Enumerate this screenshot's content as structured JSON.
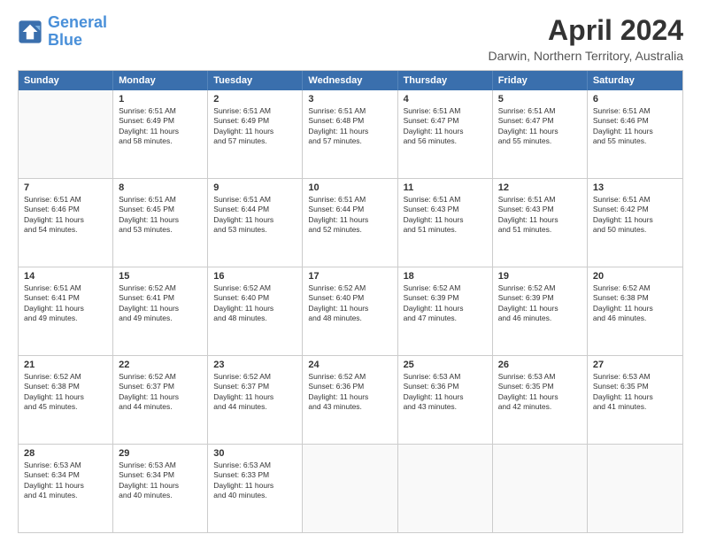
{
  "logo": {
    "line1": "General",
    "line2": "Blue"
  },
  "title": "April 2024",
  "subtitle": "Darwin, Northern Territory, Australia",
  "header_days": [
    "Sunday",
    "Monday",
    "Tuesday",
    "Wednesday",
    "Thursday",
    "Friday",
    "Saturday"
  ],
  "weeks": [
    [
      {
        "day": "",
        "info": ""
      },
      {
        "day": "1",
        "info": "Sunrise: 6:51 AM\nSunset: 6:49 PM\nDaylight: 11 hours\nand 58 minutes."
      },
      {
        "day": "2",
        "info": "Sunrise: 6:51 AM\nSunset: 6:49 PM\nDaylight: 11 hours\nand 57 minutes."
      },
      {
        "day": "3",
        "info": "Sunrise: 6:51 AM\nSunset: 6:48 PM\nDaylight: 11 hours\nand 57 minutes."
      },
      {
        "day": "4",
        "info": "Sunrise: 6:51 AM\nSunset: 6:47 PM\nDaylight: 11 hours\nand 56 minutes."
      },
      {
        "day": "5",
        "info": "Sunrise: 6:51 AM\nSunset: 6:47 PM\nDaylight: 11 hours\nand 55 minutes."
      },
      {
        "day": "6",
        "info": "Sunrise: 6:51 AM\nSunset: 6:46 PM\nDaylight: 11 hours\nand 55 minutes."
      }
    ],
    [
      {
        "day": "7",
        "info": "Sunrise: 6:51 AM\nSunset: 6:46 PM\nDaylight: 11 hours\nand 54 minutes."
      },
      {
        "day": "8",
        "info": "Sunrise: 6:51 AM\nSunset: 6:45 PM\nDaylight: 11 hours\nand 53 minutes."
      },
      {
        "day": "9",
        "info": "Sunrise: 6:51 AM\nSunset: 6:44 PM\nDaylight: 11 hours\nand 53 minutes."
      },
      {
        "day": "10",
        "info": "Sunrise: 6:51 AM\nSunset: 6:44 PM\nDaylight: 11 hours\nand 52 minutes."
      },
      {
        "day": "11",
        "info": "Sunrise: 6:51 AM\nSunset: 6:43 PM\nDaylight: 11 hours\nand 51 minutes."
      },
      {
        "day": "12",
        "info": "Sunrise: 6:51 AM\nSunset: 6:43 PM\nDaylight: 11 hours\nand 51 minutes."
      },
      {
        "day": "13",
        "info": "Sunrise: 6:51 AM\nSunset: 6:42 PM\nDaylight: 11 hours\nand 50 minutes."
      }
    ],
    [
      {
        "day": "14",
        "info": "Sunrise: 6:51 AM\nSunset: 6:41 PM\nDaylight: 11 hours\nand 49 minutes."
      },
      {
        "day": "15",
        "info": "Sunrise: 6:52 AM\nSunset: 6:41 PM\nDaylight: 11 hours\nand 49 minutes."
      },
      {
        "day": "16",
        "info": "Sunrise: 6:52 AM\nSunset: 6:40 PM\nDaylight: 11 hours\nand 48 minutes."
      },
      {
        "day": "17",
        "info": "Sunrise: 6:52 AM\nSunset: 6:40 PM\nDaylight: 11 hours\nand 48 minutes."
      },
      {
        "day": "18",
        "info": "Sunrise: 6:52 AM\nSunset: 6:39 PM\nDaylight: 11 hours\nand 47 minutes."
      },
      {
        "day": "19",
        "info": "Sunrise: 6:52 AM\nSunset: 6:39 PM\nDaylight: 11 hours\nand 46 minutes."
      },
      {
        "day": "20",
        "info": "Sunrise: 6:52 AM\nSunset: 6:38 PM\nDaylight: 11 hours\nand 46 minutes."
      }
    ],
    [
      {
        "day": "21",
        "info": "Sunrise: 6:52 AM\nSunset: 6:38 PM\nDaylight: 11 hours\nand 45 minutes."
      },
      {
        "day": "22",
        "info": "Sunrise: 6:52 AM\nSunset: 6:37 PM\nDaylight: 11 hours\nand 44 minutes."
      },
      {
        "day": "23",
        "info": "Sunrise: 6:52 AM\nSunset: 6:37 PM\nDaylight: 11 hours\nand 44 minutes."
      },
      {
        "day": "24",
        "info": "Sunrise: 6:52 AM\nSunset: 6:36 PM\nDaylight: 11 hours\nand 43 minutes."
      },
      {
        "day": "25",
        "info": "Sunrise: 6:53 AM\nSunset: 6:36 PM\nDaylight: 11 hours\nand 43 minutes."
      },
      {
        "day": "26",
        "info": "Sunrise: 6:53 AM\nSunset: 6:35 PM\nDaylight: 11 hours\nand 42 minutes."
      },
      {
        "day": "27",
        "info": "Sunrise: 6:53 AM\nSunset: 6:35 PM\nDaylight: 11 hours\nand 41 minutes."
      }
    ],
    [
      {
        "day": "28",
        "info": "Sunrise: 6:53 AM\nSunset: 6:34 PM\nDaylight: 11 hours\nand 41 minutes."
      },
      {
        "day": "29",
        "info": "Sunrise: 6:53 AM\nSunset: 6:34 PM\nDaylight: 11 hours\nand 40 minutes."
      },
      {
        "day": "30",
        "info": "Sunrise: 6:53 AM\nSunset: 6:33 PM\nDaylight: 11 hours\nand 40 minutes."
      },
      {
        "day": "",
        "info": ""
      },
      {
        "day": "",
        "info": ""
      },
      {
        "day": "",
        "info": ""
      },
      {
        "day": "",
        "info": ""
      }
    ]
  ]
}
